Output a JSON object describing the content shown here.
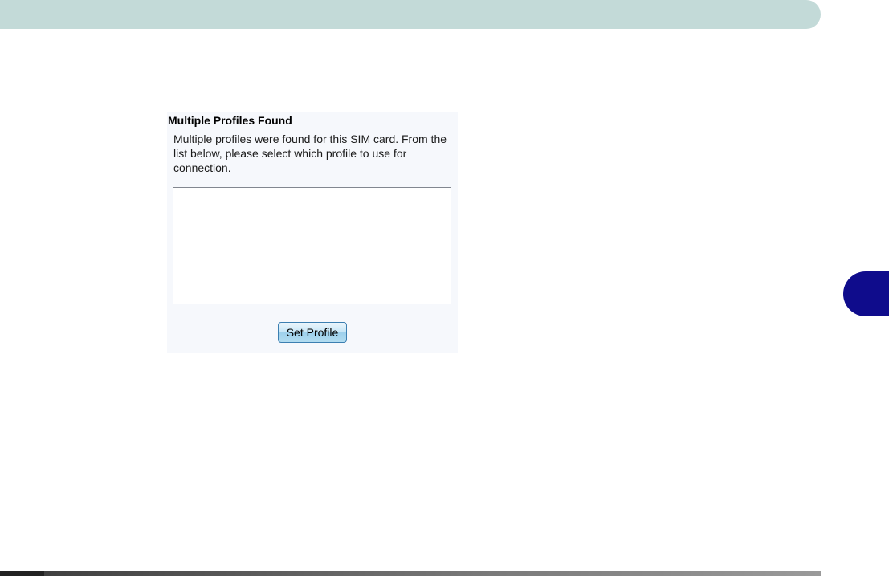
{
  "dialog": {
    "title": "Multiple Profiles Found",
    "message": "Multiple profiles were found for this SIM card. From the list below, please select which profile to use for connection.",
    "profiles": [],
    "set_profile_label": "Set Profile"
  },
  "colors": {
    "banner": "#c3dad8",
    "chapter_tab": "#0f0c8c",
    "dialog_background": "#f6f8fc"
  }
}
